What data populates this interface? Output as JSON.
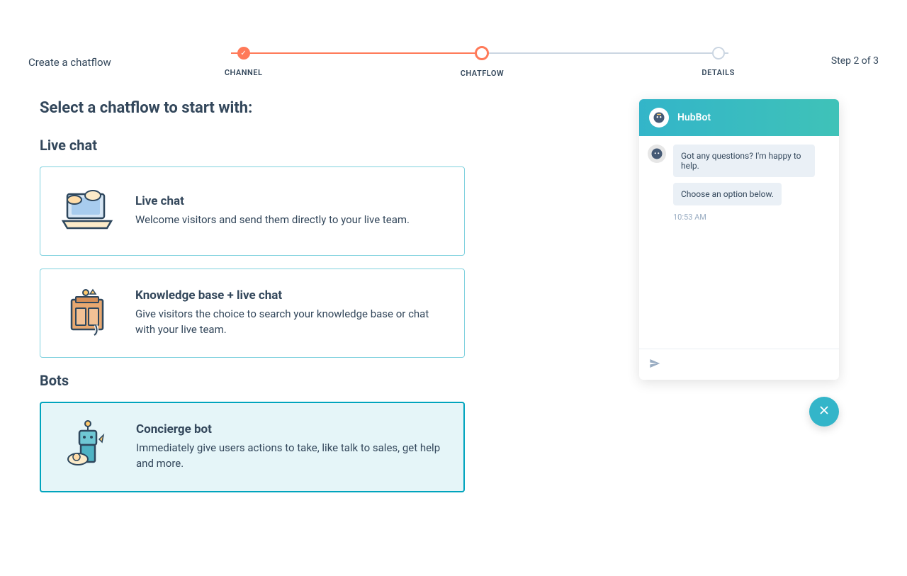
{
  "header": {
    "title": "Create a chatflow",
    "step_indicator": "Step 2 of 3"
  },
  "stepper": {
    "steps": [
      {
        "label": "CHANNEL",
        "state": "done"
      },
      {
        "label": "CHATFLOW",
        "state": "active"
      },
      {
        "label": "DETAILS",
        "state": "pending"
      }
    ]
  },
  "content": {
    "heading": "Select a chatflow to start with:",
    "groups": [
      {
        "label": "Live chat",
        "cards": [
          {
            "title": "Live chat",
            "desc": "Welcome visitors and send them directly to your live team.",
            "icon": "laptop-chat-icon",
            "selected": false
          },
          {
            "title": "Knowledge base + live chat",
            "desc": "Give visitors the choice to search your knowledge base or chat with your live team.",
            "icon": "knowledge-base-icon",
            "selected": false
          }
        ]
      },
      {
        "label": "Bots",
        "cards": [
          {
            "title": "Concierge bot",
            "desc": "Immediately give users actions to take, like talk to sales, get help and more.",
            "icon": "robot-icon",
            "selected": true
          }
        ]
      }
    ]
  },
  "preview": {
    "bot_name": "HubBot",
    "messages": [
      "Got any questions? I'm happy to help.",
      "Choose an option below."
    ],
    "time": "10:53 AM"
  }
}
